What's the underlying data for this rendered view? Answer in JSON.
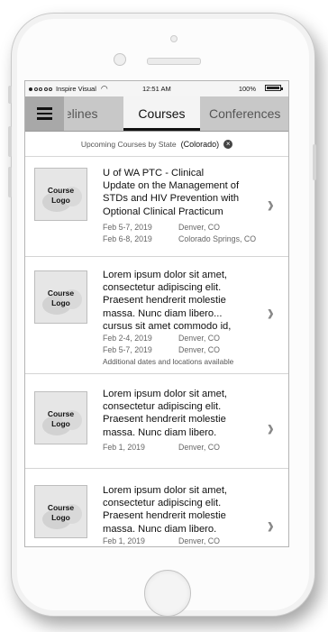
{
  "status_bar": {
    "carrier": "Inspire Visual",
    "time": "12:51 AM",
    "battery": "100%"
  },
  "tabs": {
    "prev": "idelines",
    "active": "Courses",
    "next": "Conferences"
  },
  "filter": {
    "label": "Upcoming Courses by State",
    "state": "(Colorado)"
  },
  "logo_text": [
    "Course",
    "Logo"
  ],
  "courses": [
    {
      "title": [
        "U of WA PTC - Clinical",
        "Update on the Management of",
        "STDs and HIV Prevention with",
        "Optional Clinical Practicum"
      ],
      "sessions": [
        {
          "date": "Feb 5-7, 2019",
          "location": "Denver, CO"
        },
        {
          "date": "Feb 6-8, 2019",
          "location": "Colorado Springs, CO"
        }
      ],
      "note": ""
    },
    {
      "title": [
        "Lorem ipsum dolor sit amet,",
        "consectetur adipiscing elit.",
        "Praesent hendrerit molestie",
        "massa. Nunc diam libero...",
        "cursus sit amet commodo id,"
      ],
      "sessions": [
        {
          "date": "Feb 2-4, 2019",
          "location": "Denver, CO"
        },
        {
          "date": "Feb 5-7, 2019",
          "location": "Denver, CO"
        }
      ],
      "note": "Additional dates and locations available"
    },
    {
      "title": [
        "Lorem ipsum dolor sit amet,",
        "consectetur adipiscing elit.",
        "Praesent hendrerit molestie",
        "massa. Nunc diam libero."
      ],
      "sessions": [
        {
          "date": "Feb 1, 2019",
          "location": "Denver, CO"
        }
      ],
      "note": ""
    },
    {
      "title": [
        "Lorem ipsum dolor sit amet,",
        "consectetur adipiscing elit.",
        "Praesent hendrerit molestie",
        "massa. Nunc diam libero."
      ],
      "sessions": [
        {
          "date": "Feb 1, 2019",
          "location": "Denver, CO"
        }
      ],
      "note": ""
    }
  ]
}
